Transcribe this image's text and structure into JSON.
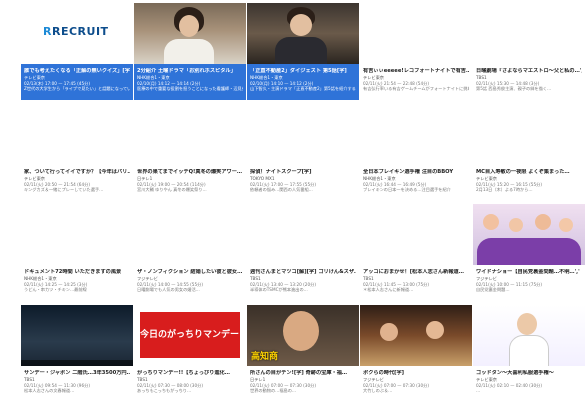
{
  "tiles": [
    {
      "title": "誰でも考えたくなる「正解の無いクイズ」[字]",
      "channel": "テレビ東京",
      "date": "02/13(木) 17:00 — 17:45 (45分)",
      "desc": "Z世代の大学生から「ライブで見たい」と話題になっているクイズ番組「…",
      "logo": "RECRUIT",
      "selected": true
    },
    {
      "title": "2分紹介 土曜ドラマ「お別れホスピタル」",
      "channel": "NHK総合1・東京",
      "date": "02/10(月) 14:12 — 14:14 (2分)",
      "desc": "医療の中で重要な役割を担うことになった看護師・辺見歩（岸井ゆきの）はど…",
      "selected": true
    },
    {
      "title": "「正直不動産2」ダイジェスト 第5話[字]",
      "channel": "NHK総合1・東京",
      "date": "02/10(月) 14:10 — 14:12 (2分)",
      "desc": "山下智久・主演ドラマ「正直不動産2」第5話を紹介する、5分で見るダイジェスト。",
      "selected": true
    },
    {
      "title": "有吉ぃぃeeeee!レコフォートナイトで有吉…",
      "channel": "テレビ東京",
      "date": "02/11(火) 21:54 — 22:48 (54分)",
      "desc": "有吉弘行率いる有吉ゲームチームがフォートナイトに挑む…"
    },
    {
      "title": "日曜劇場『さよならマエストロ～父と私の…','",
      "channel": "TBS1",
      "date": "02/11(火) 15:30 — 14:48 (3分)",
      "desc": "第5話 西島秀俊主演、親子の絆を描く…"
    },
    {
      "title": "家、ついて行ってイイですか？【今年はバリ…",
      "channel": "テレビ東京",
      "date": "02/11(火) 20:50 — 21:54 (64分)",
      "desc": "キングカズ＆一緒にプレーしていた選手…"
    },
    {
      "title": "世界の果てまでイッテQ!真冬の爆笑アワー…",
      "channel": "日テレ1",
      "date": "02/11(火) 19:00 — 20:54 (114分)",
      "desc": "宮川大輔 ゆりやん 真冬の爆笑祭り…"
    },
    {
      "title": "探偵！ナイトスクープ[字]",
      "channel": "TOKYO MX1",
      "date": "02/11(火) 17:00 — 17:55 (55分)",
      "desc": "依頼者の悩み…関西の人気番組…"
    },
    {
      "title": "全日本ブレイキン選手権 注目のBBOY",
      "channel": "NHK総合1・東京",
      "date": "02/11(火) 16:44 — 16:49 (5分)",
      "desc": "ブレイキンの日本一を決める…注目選手を紹介"
    },
    {
      "title": "MC目入寿敏の一夜限 よくぞ集まった…",
      "channel": "テレビ東京",
      "date": "02/11(火) 15:20 — 16:15 (55分)",
      "desc": "2月13日（木）よる7時から…"
    },
    {
      "title": "ドキュメント72時間 いただきますの風景",
      "channel": "NHK総合1・東京",
      "date": "02/11(火) 14:25 — 14:25 (3分)",
      "desc": "うどん・串カツ・チキン…最前線"
    },
    {
      "title": "ザ・ノンフィクション 結婚したい彼と彼女…",
      "channel": "フジテレビ",
      "date": "02/11(火) 14:00 — 14:55 (55分)",
      "desc": "日曜劇場でも人気の男女の婚活…"
    },
    {
      "title": "週刊さんまとマツコ[解][字] ゴリけん&スザ…",
      "channel": "TBS1",
      "date": "02/11(火) 13:40 — 13:20 (20分)",
      "desc": "半導体のTSMCが熊本進出の…"
    },
    {
      "title": "アッコにおまかせ！[松本人志さん新報道…",
      "channel": "TBS1",
      "date": "02/11(火) 11:45 — 13:00 (75分)",
      "desc": "＊松本人志さんに新報道…"
    },
    {
      "title": "ワイドナショー【自民党裏金問題…不明…','",
      "channel": "フジテレビ",
      "date": "02/11(火) 10:00 — 11:15 (75分)",
      "desc": "自民党裏金問題…"
    },
    {
      "title": "サンデー・ジャポン 二階氏…3年3500万円…",
      "channel": "TBS1",
      "date": "02/11(火) 09:54 — 11:30 (96分)",
      "desc": "松本人志さんの文春報道…"
    },
    {
      "title": "がっちりマンデー!!【ちょっぴり進化…",
      "channel": "TBS1",
      "date": "02/11(火) 07:30 — 08:00 (30分)",
      "desc": "あっちもこっちもがっちり…",
      "bigtext": "今日のがっちりマンデー!!"
    },
    {
      "title": "所さんの目がテン![字] 奇跡の宝庫・福…",
      "channel": "日テレ1",
      "date": "02/11(火) 07:00 — 07:30 (30分)",
      "desc": "世界の動物の…福島の…",
      "caption": "高知商"
    },
    {
      "title": "ボクらの時代[字]",
      "channel": "フジテレビ",
      "date": "02/11(火) 07:00 — 07:30 (30分)",
      "desc": "大竹しのぶ＆…"
    },
    {
      "title": "ゴッドタン～大喜利私服選手権～",
      "channel": "テレビ東京",
      "date": "02/11(火) 02:10 — 02:40 (30分)",
      "desc": "…"
    }
  ]
}
